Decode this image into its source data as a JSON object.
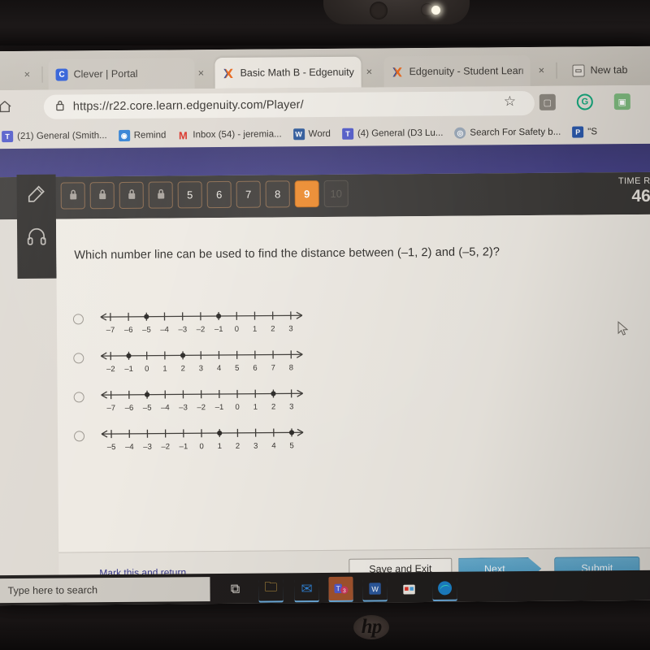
{
  "device": {
    "brand_logo": "hp"
  },
  "browser": {
    "tabs": [
      {
        "title": "Clever | Portal",
        "icon": "clever-icon",
        "active": false,
        "close_label": "×"
      },
      {
        "title": "Basic Math B - Edgenuity.cc",
        "icon": "edgenuity-icon",
        "active": true,
        "close_label": "×"
      },
      {
        "title": "Edgenuity - Student Learni",
        "icon": "edgenuity-icon",
        "active": false,
        "close_label": "×"
      },
      {
        "title": "New tab",
        "icon": "newtab-icon",
        "active": false,
        "close_label": ""
      }
    ],
    "leading_close_label": "×",
    "address": {
      "url": "https://r22.core.learn.edgenuity.com/Player/",
      "lock_icon": "lock-icon",
      "home_icon": "home-icon",
      "star_icon": "favorite-star-icon"
    },
    "extensions": [
      {
        "name": "collections-icon",
        "glyph": "⬜",
        "color": "#8a857d"
      },
      {
        "name": "grammarly-icon",
        "glyph": "G",
        "color": "#15a47a"
      },
      {
        "name": "extension-icon",
        "glyph": "⬜",
        "color": "#6fa86f"
      }
    ],
    "bookmarks": [
      {
        "label": "(21) General (Smith...",
        "icon": "teams-icon",
        "color": "#5059c9"
      },
      {
        "label": "Remind",
        "icon": "remind-icon",
        "color": "#2e7fd4"
      },
      {
        "label": "Inbox (54) - jeremia...",
        "icon": "gmail-icon",
        "color": "#d93025"
      },
      {
        "label": "Word",
        "icon": "word-icon",
        "color": "#2b579a"
      },
      {
        "label": "(4) General (D3 Lu...",
        "icon": "teams-icon",
        "color": "#5059c9"
      },
      {
        "label": "Search For Safety b...",
        "icon": "circle-icon",
        "color": "#9aa7b8"
      },
      {
        "label": "\"S",
        "icon": "pearson-icon",
        "color": "#2b57a8"
      }
    ]
  },
  "app": {
    "sidebar": [
      {
        "name": "highlighter-tool",
        "icon": "pencil-icon"
      },
      {
        "name": "audio-tool",
        "icon": "headphones-icon"
      }
    ],
    "question_tabs": [
      {
        "label": "",
        "state": "locked"
      },
      {
        "label": "",
        "state": "locked"
      },
      {
        "label": "",
        "state": "locked"
      },
      {
        "label": "",
        "state": "locked"
      },
      {
        "label": "5",
        "state": "available"
      },
      {
        "label": "6",
        "state": "available"
      },
      {
        "label": "7",
        "state": "available"
      },
      {
        "label": "8",
        "state": "available"
      },
      {
        "label": "9",
        "state": "active"
      },
      {
        "label": "10",
        "state": "disabled"
      }
    ],
    "timer": {
      "label": "TIME R",
      "value": "46"
    },
    "question": {
      "text": "Which number line can be used to find the distance between (–1, 2) and (–5, 2)?"
    },
    "options": [
      {
        "id": "A",
        "selected": false,
        "min": -7,
        "max": 3,
        "labels": [
          "–7",
          "–6",
          "–5",
          "–4",
          "–3",
          "–2",
          "–1",
          "0",
          "1",
          "2",
          "3"
        ],
        "points": [
          -5,
          -1
        ]
      },
      {
        "id": "B",
        "selected": false,
        "min": -2,
        "max": 8,
        "labels": [
          "–2",
          "–1",
          "0",
          "1",
          "2",
          "3",
          "4",
          "5",
          "6",
          "7",
          "8"
        ],
        "points": [
          -1,
          2
        ]
      },
      {
        "id": "C",
        "selected": false,
        "min": -7,
        "max": 3,
        "labels": [
          "–7",
          "–6",
          "–5",
          "–4",
          "–3",
          "–2",
          "–1",
          "0",
          "1",
          "2",
          "3"
        ],
        "points": [
          -5,
          2
        ]
      },
      {
        "id": "D",
        "selected": false,
        "min": -5,
        "max": 5,
        "labels": [
          "–5",
          "–4",
          "–3",
          "–2",
          "–1",
          "0",
          "1",
          "2",
          "3",
          "4",
          "5"
        ],
        "points": [
          1,
          5
        ]
      }
    ],
    "footer": {
      "mark_link": "Mark this and return",
      "save_exit": "Save and Exit",
      "next": "Next",
      "submit": "Submit"
    }
  },
  "taskbar": {
    "search_placeholder": "Type here to search",
    "items": [
      {
        "name": "task-view-icon",
        "glyph": "⌸",
        "color": "#d7d3cc",
        "bg": "transparent"
      },
      {
        "name": "file-explorer-icon",
        "glyph": "📁",
        "color": "#e8b54a",
        "bg": "transparent"
      },
      {
        "name": "mail-icon",
        "glyph": "✉",
        "color": "#2f7fd0",
        "bg": "transparent"
      },
      {
        "name": "teams-icon",
        "glyph": "T",
        "color": "#ffffff",
        "bg": "#5059c9"
      },
      {
        "name": "word-icon",
        "glyph": "W",
        "color": "#ffffff",
        "bg": "#2b579a"
      },
      {
        "name": "store-icon",
        "glyph": "▣",
        "color": "#d8d4cd",
        "bg": "transparent"
      },
      {
        "name": "edge-icon",
        "glyph": "◔",
        "color": "#1b8fd0",
        "bg": "transparent"
      }
    ]
  }
}
